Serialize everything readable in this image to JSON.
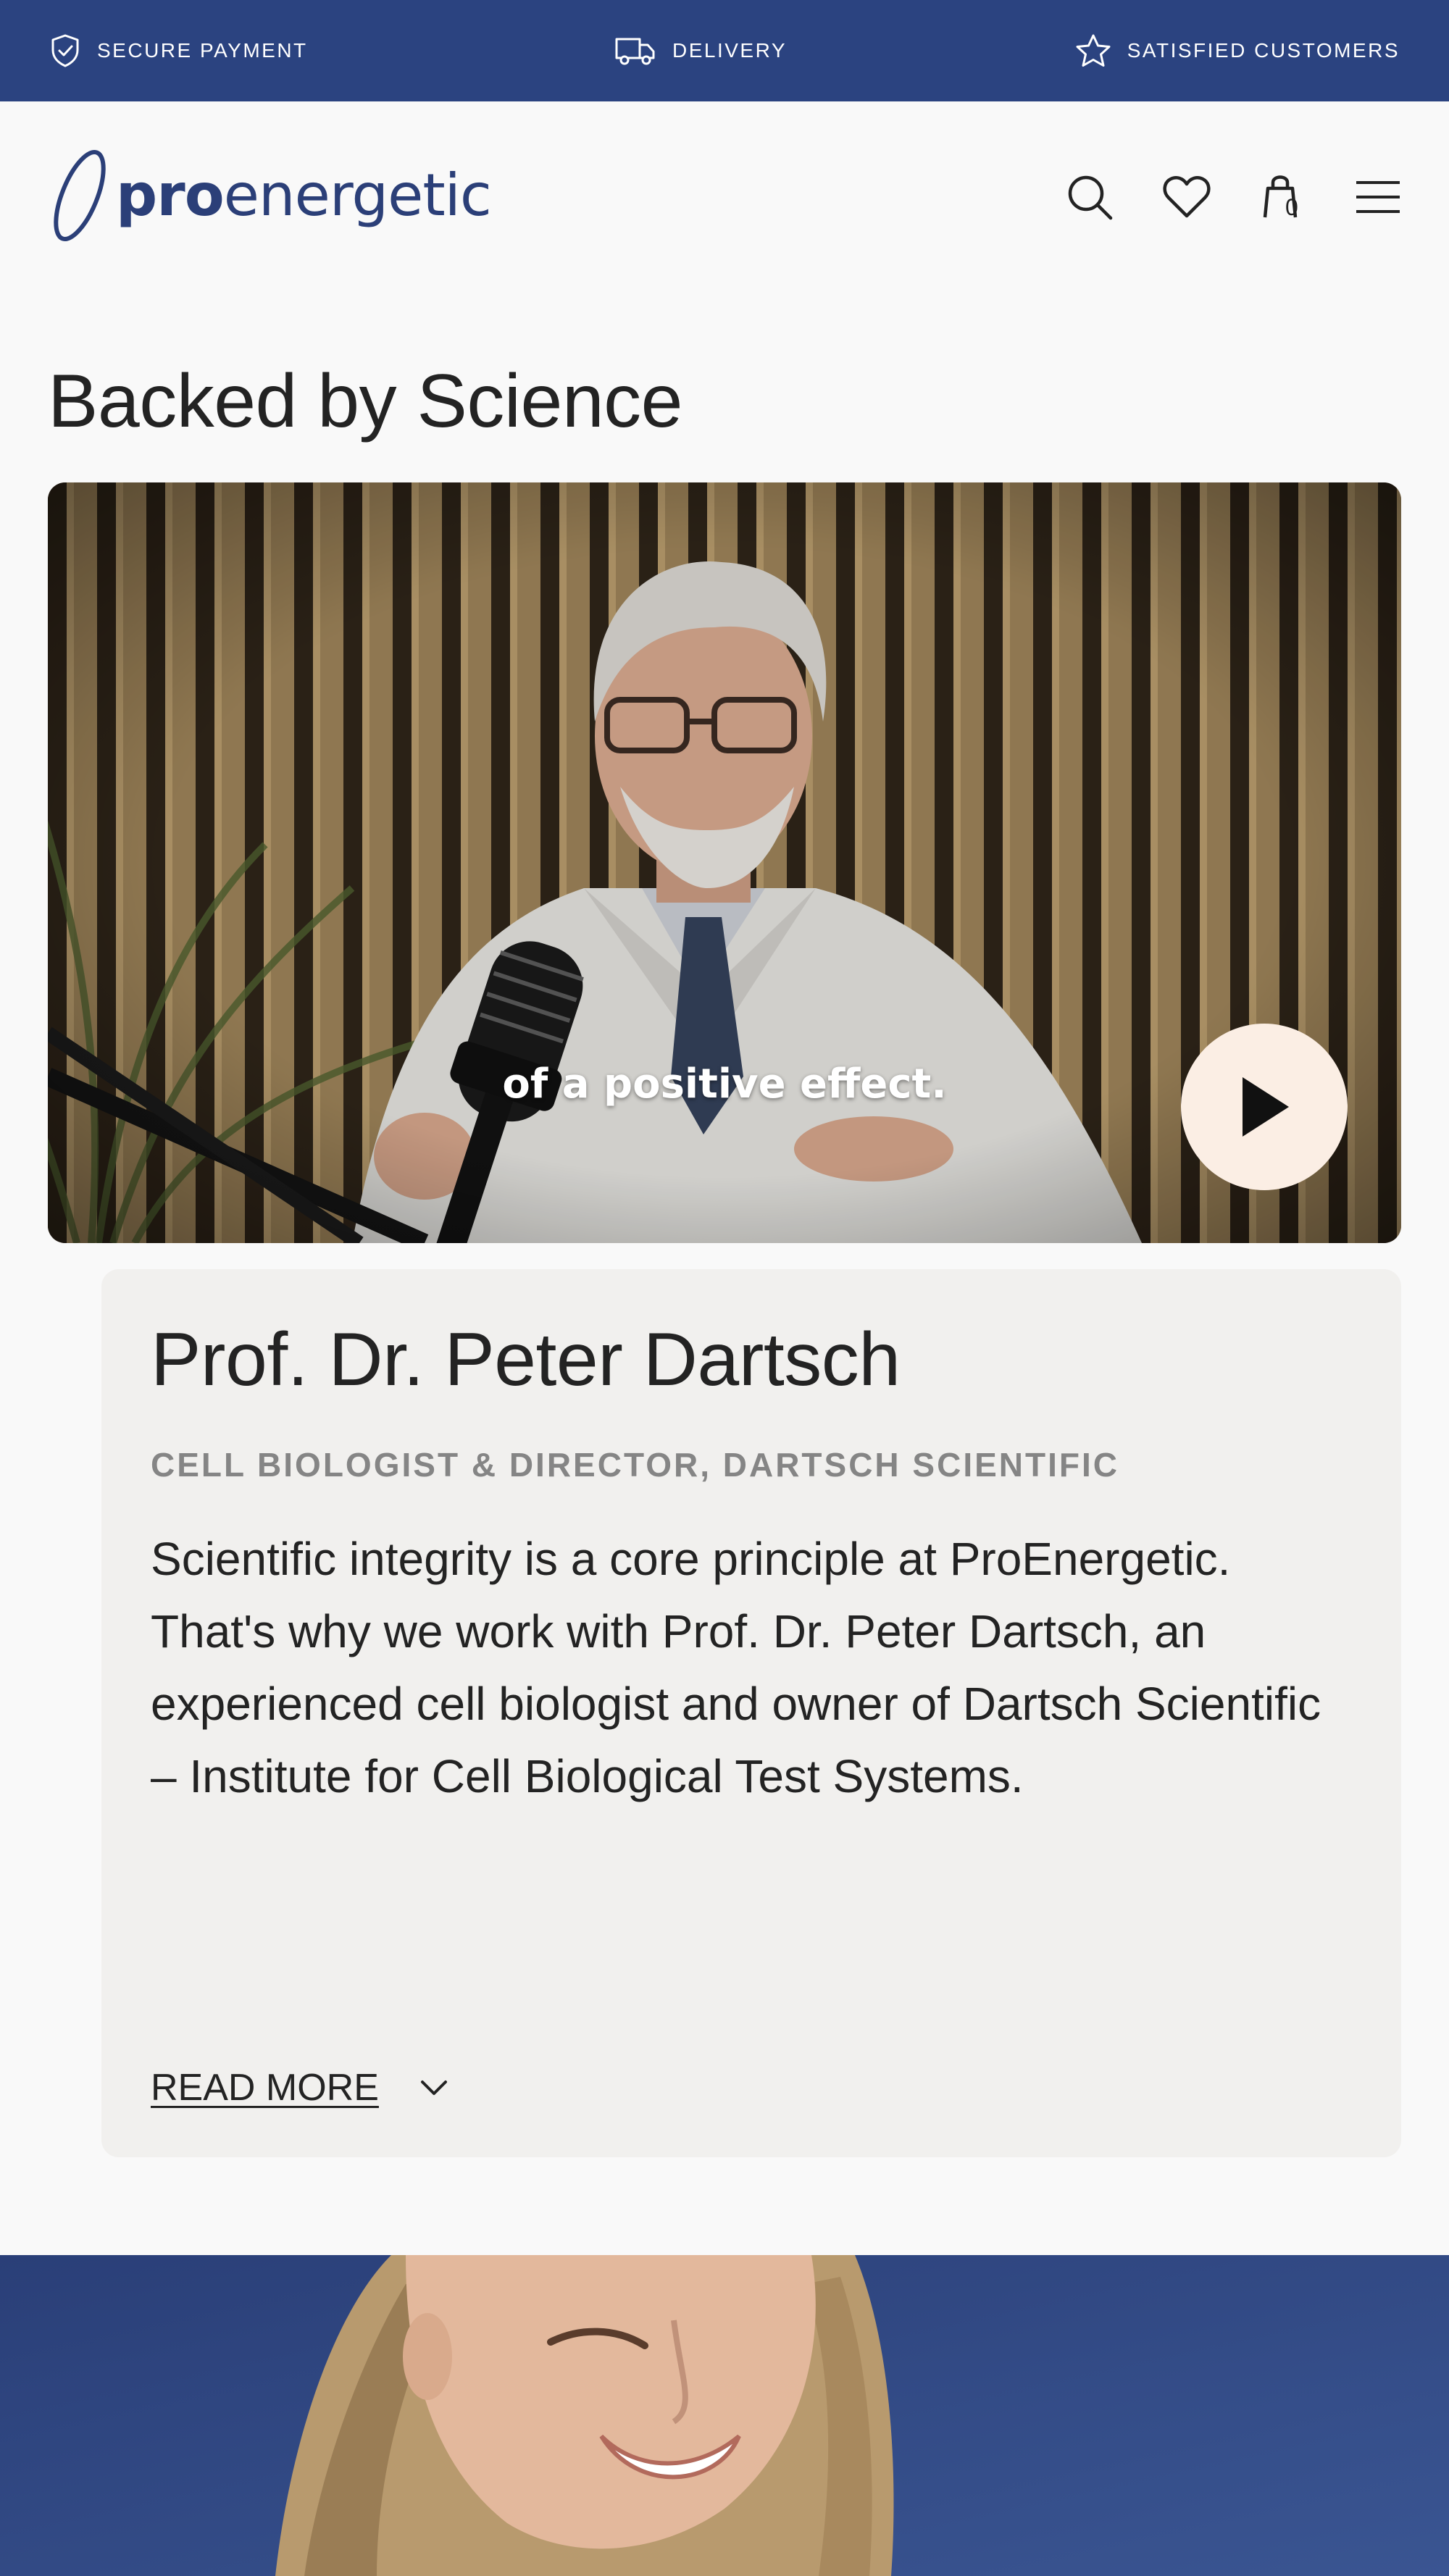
{
  "topbar": {
    "items": [
      {
        "label": "SECURE PAYMENT",
        "icon": "shield-check-icon"
      },
      {
        "label": "DELIVERY",
        "icon": "truck-icon"
      },
      {
        "label": "SATISFIED CUSTOMERS",
        "icon": "star-icon"
      }
    ],
    "background": "#2b4380"
  },
  "header": {
    "logo": {
      "text_bold": "pro",
      "text_regular": "energetic",
      "color": "#2b3f78"
    },
    "icons": [
      "search-icon",
      "heart-icon",
      "bag-icon",
      "menu-icon"
    ],
    "cart_count": "0"
  },
  "section": {
    "title": "Backed by Science"
  },
  "video": {
    "subtitle": "of a positive effect.",
    "play_icon": "play-icon",
    "play_button_color": "#fbeee4"
  },
  "bio": {
    "name": "Prof. Dr. Peter Dartsch",
    "role": "CELL BIOLOGIST & DIRECTOR, DARTSCH SCIENTIFIC",
    "text": "Scientific integrity is a core principle at ProEnergetic. That's why we work with Prof. Dr. Peter Dartsch, an experienced cell biologist and owner of Dartsch Scientific – Institute for Cell Biological Test Systems.",
    "read_more": "READ MORE",
    "read_more_icon": "chevron-down-icon"
  }
}
